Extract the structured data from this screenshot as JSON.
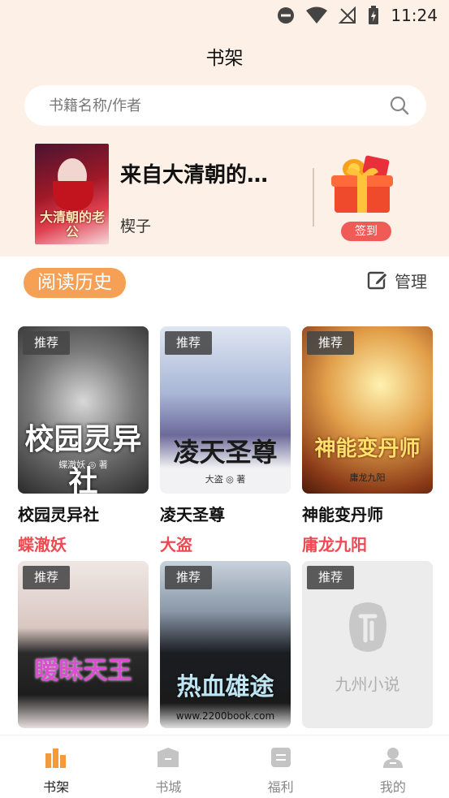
{
  "status_bar": {
    "time": "11:24"
  },
  "page": {
    "title": "书架"
  },
  "search": {
    "placeholder": "书籍名称/作者"
  },
  "recent_book": {
    "title": "来自大清朝的…",
    "author": "楔子",
    "cover_text": "大清朝的老公",
    "signin_label": "签到"
  },
  "history": {
    "tab_label": "阅读历史",
    "manage_label": "管理"
  },
  "books": [
    {
      "badge": "推荐",
      "title": "校园灵异社",
      "author": "蝶澈妖",
      "cover_text": "校园灵异社",
      "cover_sub": "蝶澈妖 ◎ 著"
    },
    {
      "badge": "推荐",
      "title": "凌天圣尊",
      "author": "大盗",
      "cover_text": "凌天圣尊",
      "cover_sub": "大盗 ◎ 著"
    },
    {
      "badge": "推荐",
      "title": "神能变丹师",
      "author": "庸龙九阳",
      "cover_text": "神能变丹师",
      "cover_sub": "庸龙九阳"
    },
    {
      "badge": "推荐",
      "cover_text": "暧昧天王"
    },
    {
      "badge": "推荐",
      "cover_text": "热血雄途",
      "cover_sub": "www.2200book.com"
    },
    {
      "badge": "推荐",
      "cover_text": "九州小说"
    }
  ],
  "nav": [
    {
      "label": "书架",
      "icon": "bookshelf-icon",
      "active": true
    },
    {
      "label": "书城",
      "icon": "bookstore-icon",
      "active": false
    },
    {
      "label": "福利",
      "icon": "welfare-icon",
      "active": false
    },
    {
      "label": "我的",
      "icon": "profile-icon",
      "active": false
    }
  ],
  "colors": {
    "accent": "#f6a055",
    "author_red": "#ee4a52",
    "header_bg": "#fdf0e6",
    "signin": "#f05a57"
  }
}
